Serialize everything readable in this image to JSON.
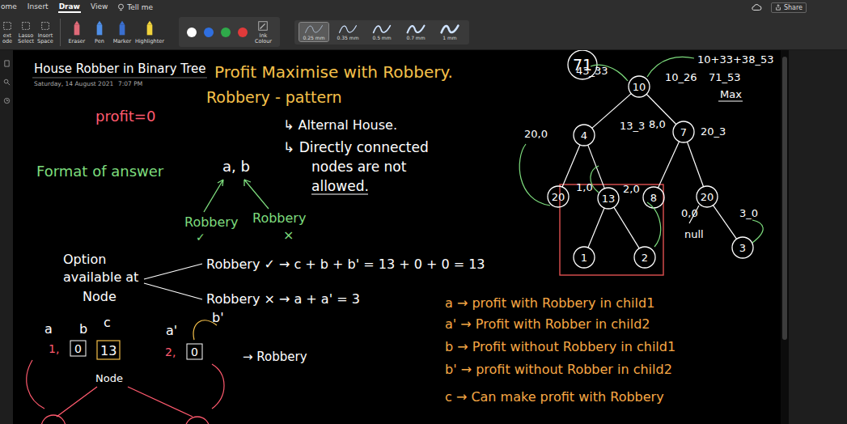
{
  "menu": [
    {
      "label": "ome",
      "selected": false
    },
    {
      "label": "Insert",
      "selected": false
    },
    {
      "label": "Draw",
      "selected": true
    },
    {
      "label": "View",
      "selected": false
    }
  ],
  "tell_me": "Tell me",
  "share": "Share",
  "tools": [
    {
      "lines": [
        "ext",
        "ode"
      ]
    },
    {
      "lines": [
        "Lasso",
        "Select"
      ]
    },
    {
      "lines": [
        "Insert",
        "Space"
      ]
    }
  ],
  "pens": [
    {
      "label": "Eraser",
      "color": "#e06a78"
    },
    {
      "label": "Pen",
      "color": "#4f8fe8"
    },
    {
      "label": "Marker",
      "color": "#3a6fd0"
    },
    {
      "label": "Highlighter",
      "color": "#f2d43c"
    }
  ],
  "ink_colors": [
    {
      "color": "#ffffff"
    },
    {
      "color": "#2f6fe0"
    },
    {
      "color": "#2faa4a"
    },
    {
      "color": "#e03a3a"
    }
  ],
  "ink_colour_label": [
    "Ink",
    "Colour"
  ],
  "stroke_widths": [
    {
      "label": "0.25 mm",
      "selected": true
    },
    {
      "label": "0.35 mm",
      "selected": false
    },
    {
      "label": "0.5 mm",
      "selected": false
    },
    {
      "label": "0.7 mm",
      "selected": false
    },
    {
      "label": "1 mm",
      "selected": false
    }
  ],
  "page": {
    "title": "House Robber in Binary Tree",
    "date": "Saturday, 14 August 2021",
    "time": "7:07 PM"
  },
  "circled_total": "71",
  "notes": [
    {
      "text": "Profit Maximise with Robbery.",
      "color": "#f5c04a"
    },
    {
      "text": "Robbery - pattern",
      "color": "#f5c04a"
    },
    {
      "text": "↳ Alternal House.",
      "color": "#ffffff"
    },
    {
      "text": "↳ Directly connected",
      "color": "#ffffff"
    },
    {
      "text": "nodes are not",
      "color": "#ffffff"
    },
    {
      "text": "allowed.",
      "color": "#ffffff"
    },
    {
      "text": "profit=0",
      "color": "#ff5a6e"
    },
    {
      "text": "Format of answer",
      "color": "#7ddc7d"
    },
    {
      "text": "a, b",
      "color": "#ffffff"
    },
    {
      "text": "Robbery",
      "color": "#7ddc7d"
    },
    {
      "text": "✓",
      "color": "#7ddc7d"
    },
    {
      "text": "Robbery",
      "color": "#7ddc7d"
    },
    {
      "text": "×",
      "color": "#7ddc7d"
    },
    {
      "text": "Option",
      "color": "#ffffff"
    },
    {
      "text": "available at",
      "color": "#ffffff"
    },
    {
      "text": "Node",
      "color": "#ffffff"
    },
    {
      "text": "Robbery ✓ → c + b + b' = 13 + 0 + 0 = 13",
      "color": "#ffffff"
    },
    {
      "text": "Robbery × → a + a' = 3",
      "color": "#ffffff"
    },
    {
      "text": "a → profit with Robbery in child1",
      "color": "#f7a845"
    },
    {
      "text": "a' → Profit with Robber in child2",
      "color": "#f7a845"
    },
    {
      "text": "b → Profit without Robbery in child1",
      "color": "#f7a845"
    },
    {
      "text": "b' → profit without Robber in child2",
      "color": "#f7a845"
    },
    {
      "text": "c → Can make profit with Robbery",
      "color": "#f7a845"
    },
    {
      "text": "a",
      "color": "#ffffff"
    },
    {
      "text": "b",
      "color": "#ffffff"
    },
    {
      "text": "1,",
      "color": "#ff5a6e"
    },
    {
      "text": "0",
      "color": "#ffffff"
    },
    {
      "text": "c",
      "color": "#ffffff"
    },
    {
      "text": "13",
      "color": "#ffffff"
    },
    {
      "text": "a'",
      "color": "#ffffff"
    },
    {
      "text": "b'",
      "color": "#ffffff"
    },
    {
      "text": "2,",
      "color": "#ff5a6e"
    },
    {
      "text": "0",
      "color": "#ffffff"
    },
    {
      "text": "Node",
      "color": "#ffffff"
    },
    {
      "text": "→ Robbery",
      "color": "#ffffff"
    }
  ],
  "tree": {
    "nodes": [
      {
        "value": "10"
      },
      {
        "value": "4"
      },
      {
        "value": "7"
      },
      {
        "value": "20"
      },
      {
        "value": "13"
      },
      {
        "value": "8"
      },
      {
        "value": "20"
      },
      {
        "value": "1"
      },
      {
        "value": "2"
      },
      {
        "value": "3"
      }
    ],
    "annotations": [
      {
        "text": "43_33"
      },
      {
        "text": "10+33+38_53"
      },
      {
        "text": "10_26"
      },
      {
        "text": "71_53"
      },
      {
        "text": "Max"
      },
      {
        "text": "20,0"
      },
      {
        "text": "13_3"
      },
      {
        "text": "8,0"
      },
      {
        "text": "20_3"
      },
      {
        "text": "1,0"
      },
      {
        "text": "2,0"
      },
      {
        "text": "0,0"
      },
      {
        "text": "3_0"
      },
      {
        "text": "null"
      }
    ]
  }
}
